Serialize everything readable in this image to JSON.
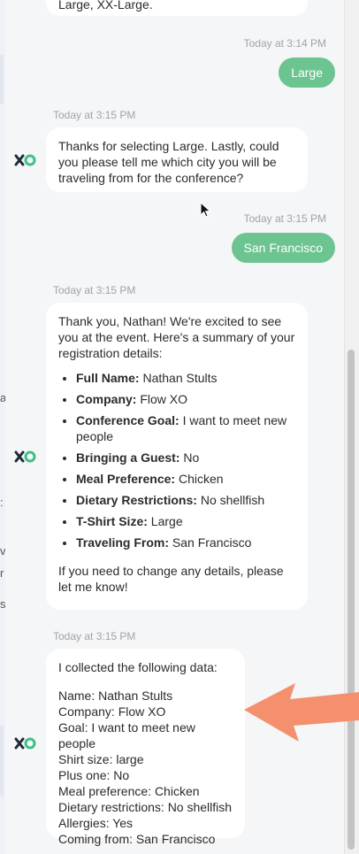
{
  "background_fragments": [
    "a",
    ":",
    "v",
    "r",
    "s"
  ],
  "messages": {
    "m0_text": "Large, XX-Large.",
    "m1_time": "Today at 3:14 PM",
    "m1_text": "Large",
    "m2_time": "Today at 3:15 PM",
    "m2_text": "Thanks for selecting Large. Lastly, could you please tell me which city you will be traveling from for the conference?",
    "m3_time": "Today at 3:15 PM",
    "m3_text": "San Francisco",
    "m4_time": "Today at 3:15 PM",
    "m4_intro": "Thank you, Nathan! We're excited to see you at the event. Here's a summary of your registration details:",
    "m4_items": [
      {
        "label": "Full Name:",
        "value": "Nathan Stults"
      },
      {
        "label": "Company:",
        "value": "Flow XO"
      },
      {
        "label": "Conference Goal:",
        "value": "I want to meet new people"
      },
      {
        "label": "Bringing a Guest:",
        "value": "No"
      },
      {
        "label": "Meal Preference:",
        "value": "Chicken"
      },
      {
        "label": "Dietary Restrictions:",
        "value": "No shellfish"
      },
      {
        "label": "T-Shirt Size:",
        "value": "Large"
      },
      {
        "label": "Traveling From:",
        "value": "San Francisco"
      }
    ],
    "m4_outro": "If you need to change any details, please let me know!",
    "m5_time": "Today at 3:15 PM",
    "m5_intro": "I collected the following data:",
    "m5_lines": [
      "Name: Nathan Stults",
      "Company: Flow XO",
      "Goal: I want to meet new people",
      "Shirt size: large",
      "Plus one: No",
      "Meal preference: Chicken",
      "Dietary restrictions: No shellfish",
      "Allergies: Yes",
      "Coming from: San Francisco"
    ]
  },
  "colors": {
    "user_bubble": "#6cc490",
    "arrow": "#f4906d",
    "avatar_dark": "#1e2a36",
    "avatar_green": "#3fbf8a"
  },
  "icons": {
    "bot_avatar": "flow-xo-logo-icon",
    "cursor": "mouse-pointer-icon",
    "annotation": "arrow-annotation-icon"
  }
}
